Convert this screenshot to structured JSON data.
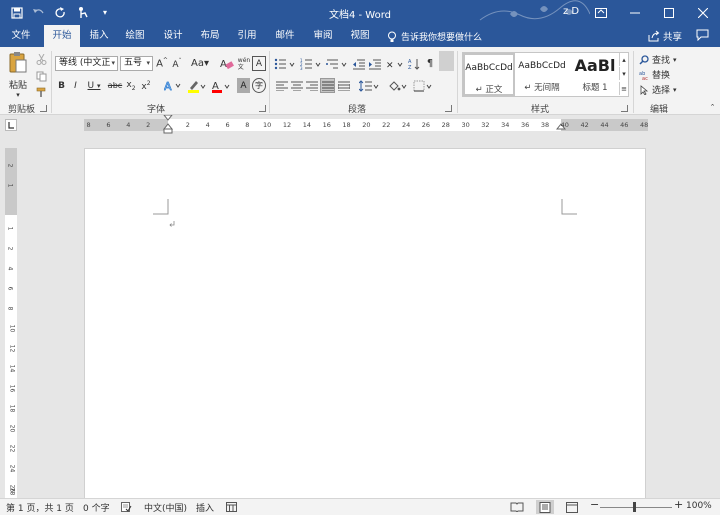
{
  "window": {
    "title": "文档4 - Word",
    "user": "z D"
  },
  "tabs": [
    {
      "label": "文件"
    },
    {
      "label": "开始"
    },
    {
      "label": "插入"
    },
    {
      "label": "绘图"
    },
    {
      "label": "设计"
    },
    {
      "label": "布局"
    },
    {
      "label": "引用"
    },
    {
      "label": "邮件"
    },
    {
      "label": "审阅"
    },
    {
      "label": "视图"
    }
  ],
  "tellme": {
    "label": "告诉我你想要做什么"
  },
  "share": {
    "label": "共享"
  },
  "ribbon": {
    "paste_label": "粘贴",
    "font_name": "等线 (中文正",
    "font_size": "五号",
    "groups": {
      "clipboard": "剪贴板",
      "font": "字体",
      "paragraph": "段落",
      "styles": "样式",
      "editing": "编辑"
    },
    "styles": [
      {
        "sample": "AaBbCcDd",
        "name": "↵ 正文"
      },
      {
        "sample": "AaBbCcDd",
        "name": "↵ 无间隔"
      },
      {
        "sample": "AaBl",
        "name": "标题 1"
      }
    ],
    "editing": [
      {
        "label": "查找"
      },
      {
        "label": "替换"
      },
      {
        "label": "选择"
      }
    ]
  },
  "ruler": {
    "h_left": [
      "8",
      "6",
      "4",
      "2"
    ],
    "h_right": [
      "2",
      "4",
      "6",
      "8",
      "10",
      "12",
      "14",
      "16",
      "18",
      "20",
      "22",
      "24",
      "26",
      "28",
      "30",
      "32",
      "34",
      "36",
      "38",
      "40",
      "42",
      "44",
      "46",
      "48"
    ],
    "v": [
      "2",
      "1",
      "1",
      "2",
      "4",
      "6",
      "8",
      "10",
      "12",
      "14",
      "16",
      "18",
      "20",
      "22",
      "24",
      "26",
      "28"
    ]
  },
  "status": {
    "page": "第 1 页，共 1 页",
    "words": "0 个字",
    "language": "中文(中国)",
    "mode": "插入",
    "zoom": "100%"
  },
  "colors": {
    "brand": "#2b579a",
    "highlight": "#ffff00",
    "font_color": "#ff0000"
  }
}
